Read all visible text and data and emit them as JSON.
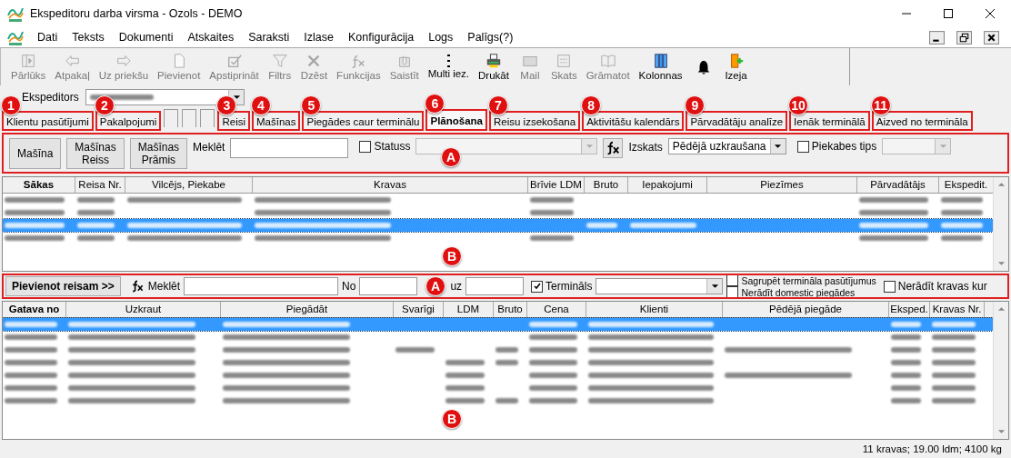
{
  "window": {
    "title": "Ekspeditoru darba virsma - Ozols - DEMO"
  },
  "menu": [
    "Dati",
    "Teksts",
    "Dokumenti",
    "Atskaites",
    "Saraksti",
    "Izlase",
    "Konfigurācija",
    "Logs",
    "Palīgs(?)"
  ],
  "toolbar": [
    {
      "label": "Pārlūks",
      "disabled": true
    },
    {
      "label": "Atpakaļ",
      "disabled": true
    },
    {
      "label": "Uz priekšu",
      "disabled": true
    },
    {
      "label": "Pievienot",
      "disabled": true
    },
    {
      "label": "Apstiprināt",
      "disabled": true
    },
    {
      "label": "Filtrs",
      "disabled": true
    },
    {
      "label": "Dzēst",
      "disabled": true
    },
    {
      "label": "Funkcijas",
      "disabled": true
    },
    {
      "label": "Saistīt",
      "disabled": true
    },
    {
      "label": "Multi iez.",
      "disabled": false
    },
    {
      "label": "Drukāt",
      "disabled": false
    },
    {
      "label": "Mail",
      "disabled": true
    },
    {
      "label": "Skats",
      "disabled": true
    },
    {
      "label": "Grāmatot",
      "disabled": true
    },
    {
      "label": "Kolonnas",
      "disabled": false
    },
    {
      "disabled": false
    },
    {
      "label": "Izeja",
      "disabled": false
    }
  ],
  "ekspeditors": {
    "label": "Ekspeditors"
  },
  "tabs": [
    {
      "kind": "label",
      "label": "Klientu pasūtījumi",
      "marker": "1",
      "selected": false
    },
    {
      "kind": "label",
      "label": "Pakalpojumi",
      "marker": "2",
      "selected": false
    },
    {
      "kind": "blank",
      "selected": false
    },
    {
      "kind": "blank",
      "selected": false
    },
    {
      "kind": "blank",
      "selected": false
    },
    {
      "kind": "label",
      "label": "Reisi",
      "marker": "3",
      "selected": false
    },
    {
      "kind": "label",
      "label": "Mašīnas",
      "marker": "4",
      "selected": false
    },
    {
      "kind": "label",
      "label": "Piegādes caur terminālu",
      "marker": "5",
      "selected": false
    },
    {
      "kind": "label",
      "label": "Plānošana",
      "marker": "6",
      "selected": true
    },
    {
      "kind": "label",
      "label": "Reisu izsekošana",
      "marker": "7",
      "selected": false
    },
    {
      "kind": "label",
      "label": "Aktivitāšu kalendārs",
      "marker": "8",
      "selected": false
    },
    {
      "kind": "label",
      "label": "Pārvadātāju analīze",
      "marker": "9",
      "selected": false
    },
    {
      "kind": "label",
      "label": "Ienāk terminālā",
      "marker": "10",
      "selected": false
    },
    {
      "kind": "label",
      "label": "Aizved no termināla",
      "marker": "11",
      "selected": false
    }
  ],
  "filter_panel": {
    "marker": "A",
    "buttons": [
      [
        "Mašīna"
      ],
      [
        "Mašīnas",
        "Reiss"
      ],
      [
        "Mašīnas",
        "Prāmis"
      ]
    ],
    "search_label": "Meklēt",
    "status": {
      "label": "Statuss",
      "checked": false
    },
    "view_label": "Izskats",
    "view_value": "Pēdējā uzkraušana",
    "trailer": {
      "label": "Piekabes tips",
      "checked": false
    }
  },
  "trips_table": {
    "marker": "B",
    "columns": [
      "Sākas",
      "Reisa Nr.",
      "Vilcējs, Piekabe",
      "Kravas",
      "Brīvie LDM",
      "Bruto",
      "Iepakojumi",
      "Piezīmes",
      "Pārvadātājs",
      "Ekspedit."
    ],
    "rows": [
      {
        "selected": false,
        "cells": [
          {
            "blurred": true
          },
          {
            "blurred": true
          },
          {
            "blurred": true
          },
          {
            "blurred": true
          },
          {
            "blurred": true
          },
          {
            "blurred": false
          },
          {
            "blurred": false
          },
          {
            "blurred": false
          },
          {
            "blurred": true
          },
          {
            "blurred": true
          }
        ]
      },
      {
        "selected": false,
        "cells": [
          {
            "blurred": true
          },
          {
            "blurred": true
          },
          {
            "blurred": false
          },
          {
            "blurred": true
          },
          {
            "blurred": true
          },
          {
            "blurred": false
          },
          {
            "blurred": false
          },
          {
            "blurred": false
          },
          {
            "blurred": true
          },
          {
            "blurred": true
          }
        ]
      },
      {
        "selected": true,
        "cells": [
          {
            "blurred": true
          },
          {
            "blurred": true
          },
          {
            "blurred": true
          },
          {
            "blurred": true
          },
          {
            "blurred": false
          },
          {
            "blurred": true
          },
          {
            "blurred": true
          },
          {
            "blurred": false
          },
          {
            "blurred": true
          },
          {
            "blurred": true
          }
        ]
      },
      {
        "selected": false,
        "cells": [
          {
            "blurred": true
          },
          {
            "blurred": true
          },
          {
            "blurred": true
          },
          {
            "blurred": true
          },
          {
            "blurred": true
          },
          {
            "blurred": false
          },
          {
            "blurred": false
          },
          {
            "blurred": false
          },
          {
            "blurred": true
          },
          {
            "blurred": true
          }
        ]
      }
    ]
  },
  "add_bar": {
    "marker": "A",
    "button": "Pievienot reisam >>",
    "search_label": "Meklēt",
    "from_label": "No",
    "to_label": "uz",
    "terminal": {
      "label": "Termināls",
      "checked": true
    },
    "group": {
      "label": "Sagrupēt termināla pasūtījumus",
      "checked": false
    },
    "domestic": {
      "label": "Nerādīt domestic piegādes",
      "checked": false
    },
    "hide_cargo": {
      "label": "Nerādīt kravas kur",
      "checked": false
    }
  },
  "cargo_table": {
    "marker": "B",
    "columns": [
      "Gatava no",
      "Uzkraut",
      "Piegādāt",
      "Svarīgi",
      "LDM",
      "Bruto",
      "Cena",
      "Klienti",
      "Pēdējā piegāde",
      "Eksped.",
      "Kravas Nr."
    ],
    "rows": [
      {
        "selected": true,
        "cells": [
          {
            "blurred": true
          },
          {
            "blurred": true
          },
          {
            "blurred": true
          },
          {
            "blurred": false
          },
          {
            "blurred": false
          },
          {
            "blurred": false
          },
          {
            "blurred": true
          },
          {
            "blurred": true
          },
          {
            "blurred": false
          },
          {
            "blurred": true
          },
          {
            "blurred": true
          }
        ]
      },
      {
        "selected": false,
        "cells": [
          {
            "blurred": true
          },
          {
            "blurred": true
          },
          {
            "blurred": true
          },
          {
            "blurred": false
          },
          {
            "blurred": false
          },
          {
            "blurred": false
          },
          {
            "blurred": true
          },
          {
            "blurred": true
          },
          {
            "blurred": false
          },
          {
            "blurred": true
          },
          {
            "blurred": true
          }
        ]
      },
      {
        "selected": false,
        "cells": [
          {
            "blurred": true
          },
          {
            "blurred": true
          },
          {
            "blurred": true
          },
          {
            "blurred": true
          },
          {
            "blurred": false
          },
          {
            "blurred": true
          },
          {
            "blurred": true
          },
          {
            "blurred": true
          },
          {
            "blurred": true
          },
          {
            "blurred": true
          },
          {
            "blurred": true
          }
        ]
      },
      {
        "selected": false,
        "cells": [
          {
            "blurred": true
          },
          {
            "blurred": true
          },
          {
            "blurred": true
          },
          {
            "blurred": false
          },
          {
            "blurred": true
          },
          {
            "blurred": true
          },
          {
            "blurred": true
          },
          {
            "blurred": true
          },
          {
            "blurred": false
          },
          {
            "blurred": true
          },
          {
            "blurred": true
          }
        ]
      },
      {
        "selected": false,
        "cells": [
          {
            "blurred": true
          },
          {
            "blurred": true
          },
          {
            "blurred": true
          },
          {
            "blurred": false
          },
          {
            "blurred": true
          },
          {
            "blurred": false
          },
          {
            "blurred": true
          },
          {
            "blurred": true
          },
          {
            "blurred": true
          },
          {
            "blurred": true
          },
          {
            "blurred": true
          }
        ]
      },
      {
        "selected": false,
        "cells": [
          {
            "blurred": true
          },
          {
            "blurred": true
          },
          {
            "blurred": true
          },
          {
            "blurred": false
          },
          {
            "blurred": true
          },
          {
            "blurred": false
          },
          {
            "blurred": true
          },
          {
            "blurred": true
          },
          {
            "blurred": false
          },
          {
            "blurred": true
          },
          {
            "blurred": true
          }
        ]
      },
      {
        "selected": false,
        "cells": [
          {
            "blurred": true
          },
          {
            "blurred": true
          },
          {
            "blurred": true
          },
          {
            "blurred": false
          },
          {
            "blurred": true
          },
          {
            "blurred": true
          },
          {
            "blurred": true
          },
          {
            "blurred": true
          },
          {
            "blurred": false
          },
          {
            "blurred": true
          },
          {
            "blurred": true
          }
        ]
      }
    ]
  },
  "status_bar": "11 kravas; 19.00 ldm; 4100 kg"
}
